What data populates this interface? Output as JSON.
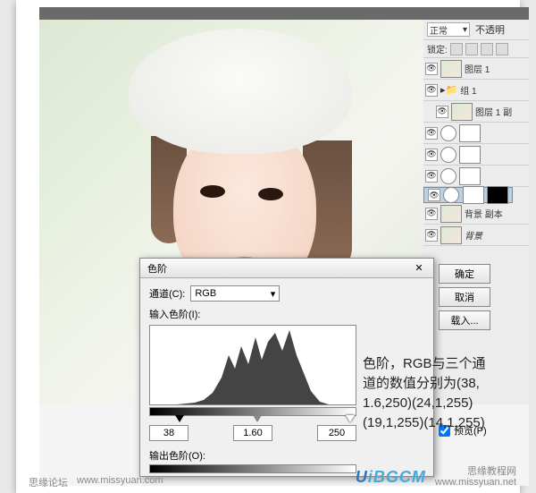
{
  "topbar": {},
  "right_panel": {
    "mode": "正常",
    "opacity_label": "不透明",
    "lock_label": "锁定:",
    "layers": [
      {
        "name": "图层 1",
        "type": "image"
      },
      {
        "name": "组 1",
        "type": "group"
      },
      {
        "name": "图层 1 副",
        "type": "image",
        "indent": true
      },
      {
        "name": "",
        "type": "adjustment"
      },
      {
        "name": "",
        "type": "adjustment"
      },
      {
        "name": "",
        "type": "adjustment"
      },
      {
        "name": "",
        "type": "adjustment",
        "selected": true
      },
      {
        "name": "背景 副本",
        "type": "image"
      },
      {
        "name": "背景",
        "type": "image",
        "italic": true
      }
    ]
  },
  "dialog": {
    "title": "色阶",
    "channel_label": "通道(C):",
    "channel_value": "RGB",
    "input_label": "输入色阶(I):",
    "output_label": "输出色阶(O):",
    "input_values": {
      "black": "38",
      "gamma": "1.60",
      "white": "250"
    },
    "buttons": {
      "ok": "确定",
      "cancel": "取消",
      "load": "载入..."
    },
    "preview_label": "预览(P)",
    "preview_checked": true
  },
  "annotation": {
    "line1": "色阶，RGB与三个通",
    "line2": "道的数值分别为(38,",
    "line3": "1.6,250)(24,1,255)",
    "line4": "(19,1,255)(14,1,255)"
  },
  "chart_data": {
    "type": "histogram",
    "title": "输入色阶",
    "xlim": [
      0,
      255
    ],
    "note": "Luminance histogram; dense peaks between ~90 and 225, tall spike near 220, low values below 60",
    "input_levels": {
      "black": 38,
      "gamma": 1.6,
      "white": 250
    },
    "channel_adjustments": [
      {
        "channel": "RGB",
        "black": 38,
        "gamma": 1.6,
        "white": 250
      },
      {
        "channel": "R",
        "black": 24,
        "gamma": 1.0,
        "white": 255
      },
      {
        "channel": "G",
        "black": 19,
        "gamma": 1.0,
        "white": 255
      },
      {
        "channel": "B",
        "black": 14,
        "gamma": 1.0,
        "white": 255
      }
    ]
  },
  "footer": {
    "forum": "思缘论坛",
    "forum_url": "www.missyuan.com",
    "site_cn": "思缘教程网",
    "site_url": "www.missyuan.net",
    "logo": "UiBGCM"
  }
}
